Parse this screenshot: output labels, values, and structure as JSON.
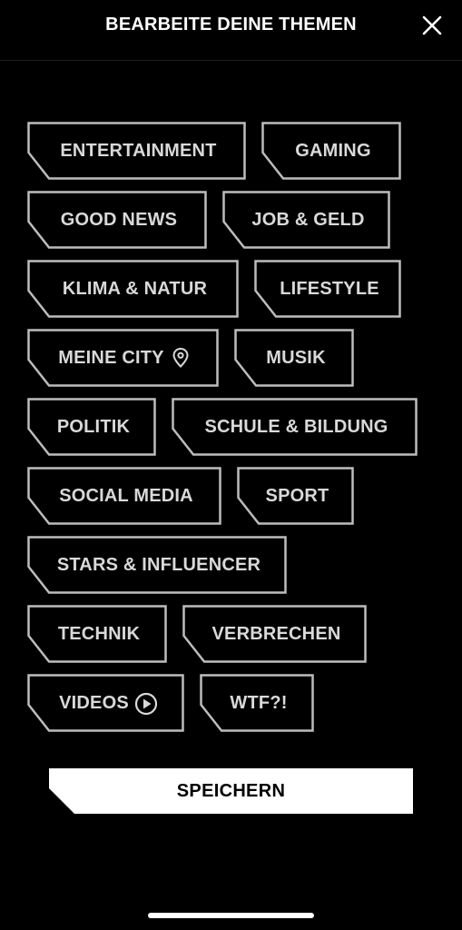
{
  "header": {
    "title": "BEARBEITE DEINE THEMEN",
    "close_icon": "close-icon"
  },
  "topics": [
    {
      "label": "ENTERTAINMENT"
    },
    {
      "label": "GAMING"
    },
    {
      "label": "GOOD NEWS"
    },
    {
      "label": "JOB & GELD"
    },
    {
      "label": "KLIMA & NATUR"
    },
    {
      "label": "LIFESTYLE"
    },
    {
      "label": "MEINE CITY",
      "icon": "location-pin-icon"
    },
    {
      "label": "MUSIK"
    },
    {
      "label": "POLITIK"
    },
    {
      "label": "SCHULE & BILDUNG"
    },
    {
      "label": "SOCIAL MEDIA"
    },
    {
      "label": "SPORT"
    },
    {
      "label": "STARS & INFLUENCER"
    },
    {
      "label": "TECHNIK"
    },
    {
      "label": "VERBRECHEN"
    },
    {
      "label": "VIDEOS",
      "icon": "play-circle-icon"
    },
    {
      "label": "WTF?!"
    }
  ],
  "save_button": {
    "label": "SPEICHERN"
  },
  "colors": {
    "background": "#000000",
    "tag_border": "#bdbdbd",
    "tag_text": "#d9d9d9",
    "button_fill": "#ffffff"
  }
}
